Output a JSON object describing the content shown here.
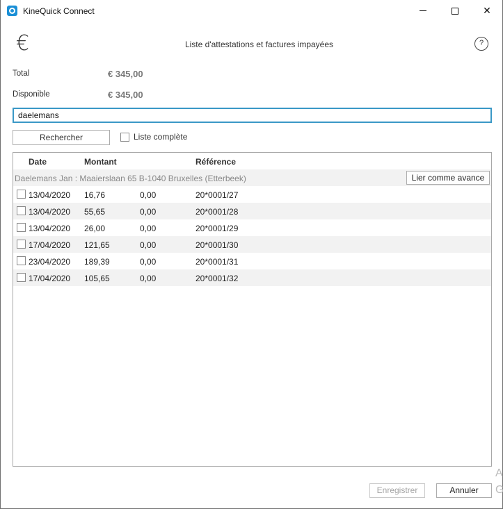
{
  "window": {
    "title": "KineQuick Connect"
  },
  "header": {
    "title": "Liste d'attestations et factures impayées",
    "help": "?",
    "euro_symbol": "€"
  },
  "summary": {
    "total_label": "Total",
    "total_value": "€  345,00",
    "available_label": "Disponible",
    "available_value": "€  345,00"
  },
  "search": {
    "value": "daelemans",
    "button_label": "Rechercher",
    "full_list_label": "Liste complète",
    "full_list_checked": false
  },
  "table": {
    "columns": [
      "Date",
      "Montant",
      "Référence"
    ],
    "group": {
      "label": "Daelemans Jan : Maaierslaan 65 B-1040 Bruxelles (Etterbeek)",
      "action_label": "Lier comme avance"
    },
    "rows": [
      {
        "date": "13/04/2020",
        "amount": "16,76",
        "paid": "0,00",
        "reference": "20*0001/27",
        "checked": false
      },
      {
        "date": "13/04/2020",
        "amount": "55,65",
        "paid": "0,00",
        "reference": "20*0001/28",
        "checked": false
      },
      {
        "date": "13/04/2020",
        "amount": "26,00",
        "paid": "0,00",
        "reference": "20*0001/29",
        "checked": false
      },
      {
        "date": "17/04/2020",
        "amount": "121,65",
        "paid": "0,00",
        "reference": "20*0001/30",
        "checked": false
      },
      {
        "date": "23/04/2020",
        "amount": "189,39",
        "paid": "0,00",
        "reference": "20*0001/31",
        "checked": false
      },
      {
        "date": "17/04/2020",
        "amount": "105,65",
        "paid": "0,00",
        "reference": "20*0001/32",
        "checked": false
      }
    ]
  },
  "footer": {
    "save_label": "Enregistrer",
    "cancel_label": "Annuler"
  },
  "edge_fragments": {
    "a": "A",
    "g": "G"
  },
  "colors": {
    "accent_focus": "#3a98c6",
    "app_icon": "#1a8fd6",
    "disabled_text": "#a3a3a3"
  }
}
